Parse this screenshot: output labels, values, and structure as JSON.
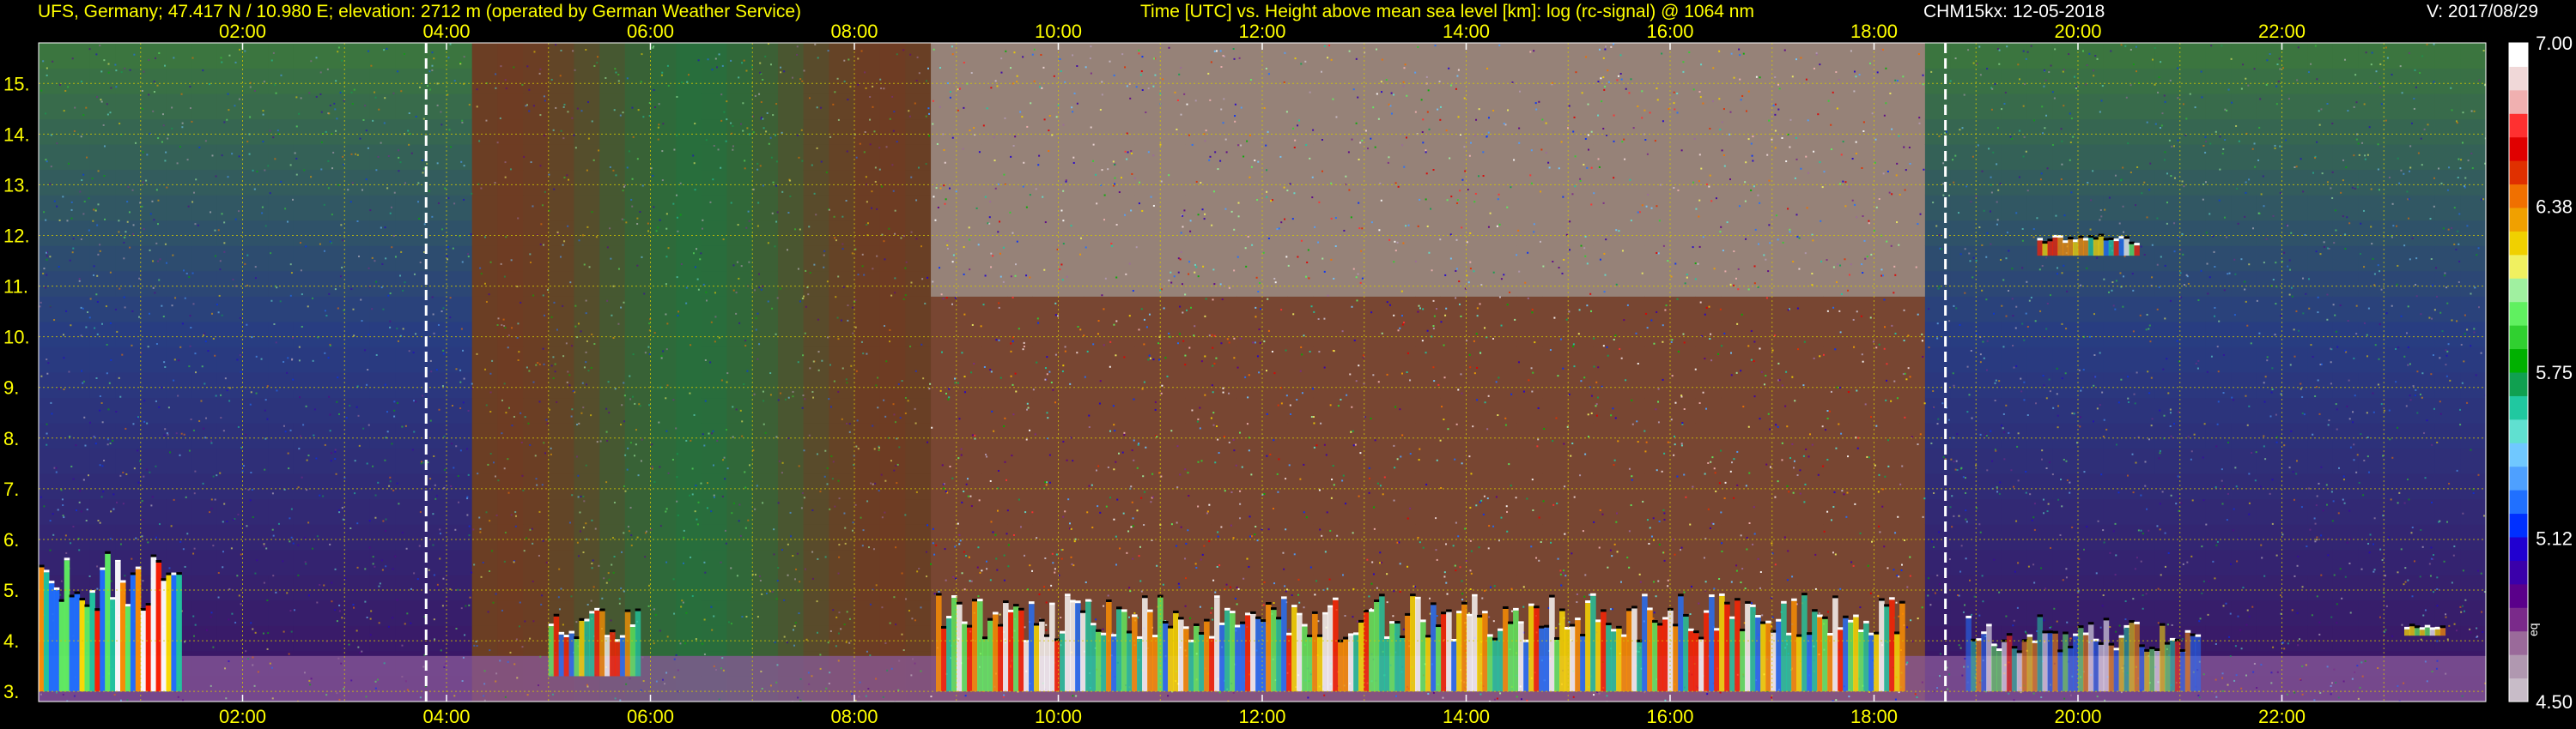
{
  "header": {
    "station": "UFS, Germany; 47.417 N / 10.980 E; elevation: 2712 m  (operated by German Weather Service)",
    "title": "Time [UTC] vs. Height above mean sea level [km]: log (rc-signal) @ 1064 nm",
    "instrument": "CHM15kx: 12-05-2018",
    "version": "V: 2017/08/29"
  },
  "colors": {
    "background": "#000000",
    "text": "#ffff00",
    "white_text": "#ffffff",
    "grid": "#d4c800",
    "marker": "#ffffff"
  },
  "chart_data": {
    "type": "heatmap",
    "title": "Time [UTC] vs. Height above mean sea level [km]: log (rc-signal) @ 1064 nm",
    "xlabel": "Time [UTC]",
    "ylabel": "Height above mean sea level [km]",
    "x_ticks": [
      "02:00",
      "04:00",
      "06:00",
      "08:00",
      "10:00",
      "12:00",
      "14:00",
      "16:00",
      "18:00",
      "20:00",
      "22:00"
    ],
    "x_tick_hours": [
      2,
      4,
      6,
      8,
      10,
      12,
      14,
      16,
      18,
      20,
      22
    ],
    "xlim_hours": [
      0,
      24
    ],
    "y_ticks": [
      "3.",
      "4.",
      "5.",
      "6.",
      "7.",
      "8.",
      "9.",
      "10.",
      "11.",
      "12.",
      "13.",
      "14.",
      "15."
    ],
    "y_tick_values": [
      3,
      4,
      5,
      6,
      7,
      8,
      9,
      10,
      11,
      12,
      13,
      14,
      15
    ],
    "ylim": [
      2.8,
      15.8
    ],
    "grid": true,
    "vertical_markers_hours": [
      3.8,
      18.7
    ],
    "colorbar": {
      "range": [
        4.5,
        7.0
      ],
      "tick_labels": [
        "7.00",
        "6.38",
        "5.75",
        "5.12",
        "4.50"
      ],
      "tick_values": [
        7.0,
        6.38,
        5.75,
        5.12,
        4.5
      ],
      "minor_label": "eq",
      "colors": [
        "#c8bcc8",
        "#b098b0",
        "#9a6a9a",
        "#7a2a8a",
        "#5a008a",
        "#3a00aa",
        "#2000d0",
        "#0030ff",
        "#2070ff",
        "#4ea0ff",
        "#70c8ff",
        "#60e0d0",
        "#20c8a0",
        "#10a050",
        "#00b000",
        "#30d030",
        "#60f060",
        "#a0f0a0",
        "#f0f060",
        "#f0d000",
        "#f0a000",
        "#f07000",
        "#e03000",
        "#e00000",
        "#ff3030",
        "#f0b0b0",
        "#f0d8d8",
        "#ffffff"
      ]
    },
    "cloud_layers": [
      {
        "start_hour": 0.0,
        "end_hour": 1.4,
        "base_km": 3.0,
        "top_km": 5.8,
        "intensity": 0.95
      },
      {
        "start_hour": 5.0,
        "end_hour": 5.9,
        "base_km": 3.3,
        "top_km": 4.6,
        "intensity": 0.75
      },
      {
        "start_hour": 8.8,
        "end_hour": 18.3,
        "base_km": 3.0,
        "top_km": 4.9,
        "intensity": 0.8
      },
      {
        "start_hour": 18.9,
        "end_hour": 21.2,
        "base_km": 3.0,
        "top_km": 4.5,
        "intensity": 0.55
      },
      {
        "start_hour": 19.6,
        "end_hour": 20.6,
        "base_km": 11.6,
        "top_km": 12.0,
        "intensity": 0.7
      },
      {
        "start_hour": 23.2,
        "end_hour": 23.6,
        "base_km": 4.1,
        "top_km": 4.3,
        "intensity": 0.7
      }
    ]
  }
}
